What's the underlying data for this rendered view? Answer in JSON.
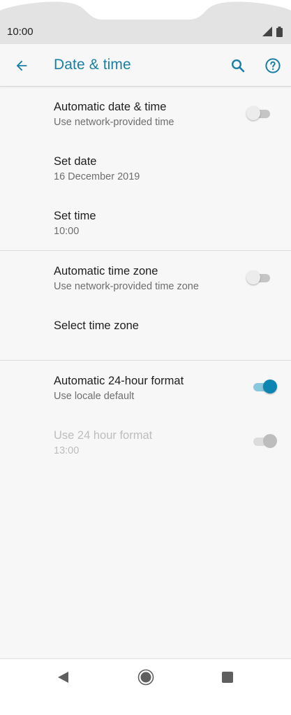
{
  "status_bar": {
    "time": "10:00",
    "icons": [
      "signal-icon",
      "battery-icon"
    ]
  },
  "app_bar": {
    "title": "Date & time",
    "icons": [
      "back-arrow-icon",
      "search-icon",
      "help-icon"
    ],
    "accent_color": "#1a7ea6"
  },
  "settings": {
    "automatic_date_time": {
      "title": "Automatic date & time",
      "summary": "Use network-provided time",
      "toggle": "off"
    },
    "set_date": {
      "title": "Set date",
      "summary": "16 December 2019"
    },
    "set_time": {
      "title": "Set time",
      "summary": "10:00"
    },
    "automatic_time_zone": {
      "title": "Automatic time zone",
      "summary": "Use network-provided time zone",
      "toggle": "off"
    },
    "select_time_zone": {
      "title": "Select time zone"
    },
    "automatic_24_hour": {
      "title": "Automatic 24-hour format",
      "summary": "Use locale default",
      "toggle": "on"
    },
    "use_24_hour": {
      "title": "Use 24 hour format",
      "summary": "13:00",
      "toggle": "on",
      "enabled": false
    }
  },
  "nav_bar": {
    "icons": [
      "nav-back-icon",
      "nav-home-icon",
      "nav-recents-icon"
    ]
  },
  "colors": {
    "accent": "#1a7ea6",
    "switch_on": "#0d85b0",
    "background": "#f7f7f7"
  }
}
